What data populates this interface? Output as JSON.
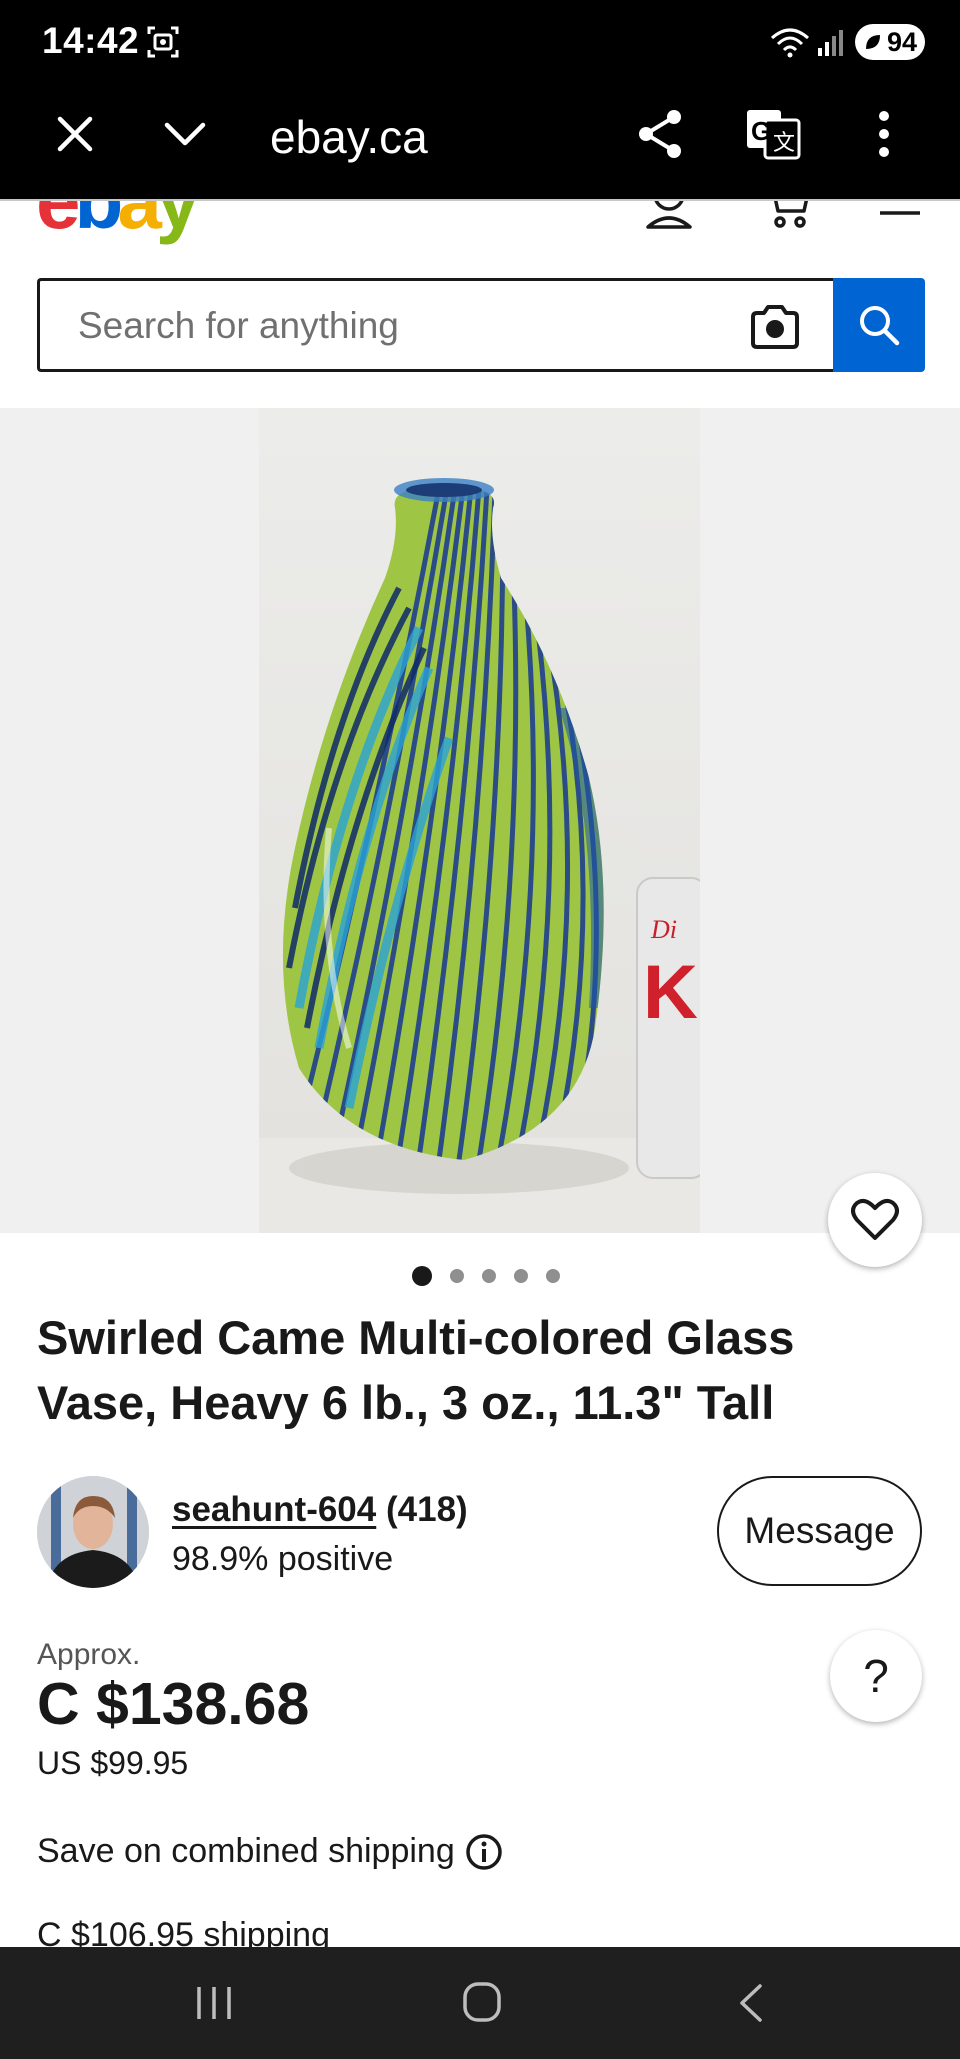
{
  "status_bar": {
    "time": "14:42",
    "battery": "94"
  },
  "browser": {
    "url": "ebay.ca"
  },
  "ebay": {
    "logo": [
      "e",
      "b",
      "a",
      "y"
    ],
    "colors": {
      "red": "#e53238",
      "blue": "#0064d2",
      "yellow": "#f5af02",
      "green": "#86b817"
    }
  },
  "search": {
    "placeholder": "Search for anything",
    "value": ""
  },
  "gallery": {
    "image_count": 5,
    "active_index": 1
  },
  "item": {
    "title": "Swirled Came Multi-colored Glass Vase, Heavy 6 lb., 3 oz., 11.3\" Tall"
  },
  "seller": {
    "name": "seahunt-604",
    "count": "(418)",
    "feedback": "98.9% positive",
    "message_label": "Message"
  },
  "price": {
    "approx_label": "Approx.",
    "cad": "C $138.68",
    "usd": "US $99.95"
  },
  "shipping": {
    "combined": "Save on combined shipping",
    "cost": "C $106.95 shipping"
  },
  "help": {
    "label": "?"
  },
  "icons": {
    "screenshot": "screenshot-icon",
    "wifi": "wifi-icon",
    "signal": "signal-icon",
    "close": "close-icon",
    "chevron": "chevron-down-icon",
    "share": "share-icon",
    "translate": "translate-icon",
    "more": "more-vertical-icon",
    "account": "account-icon",
    "cart": "cart-icon",
    "menu": "menu-icon",
    "camera": "camera-icon",
    "search": "search-icon",
    "heart": "heart-icon",
    "info": "info-icon"
  }
}
